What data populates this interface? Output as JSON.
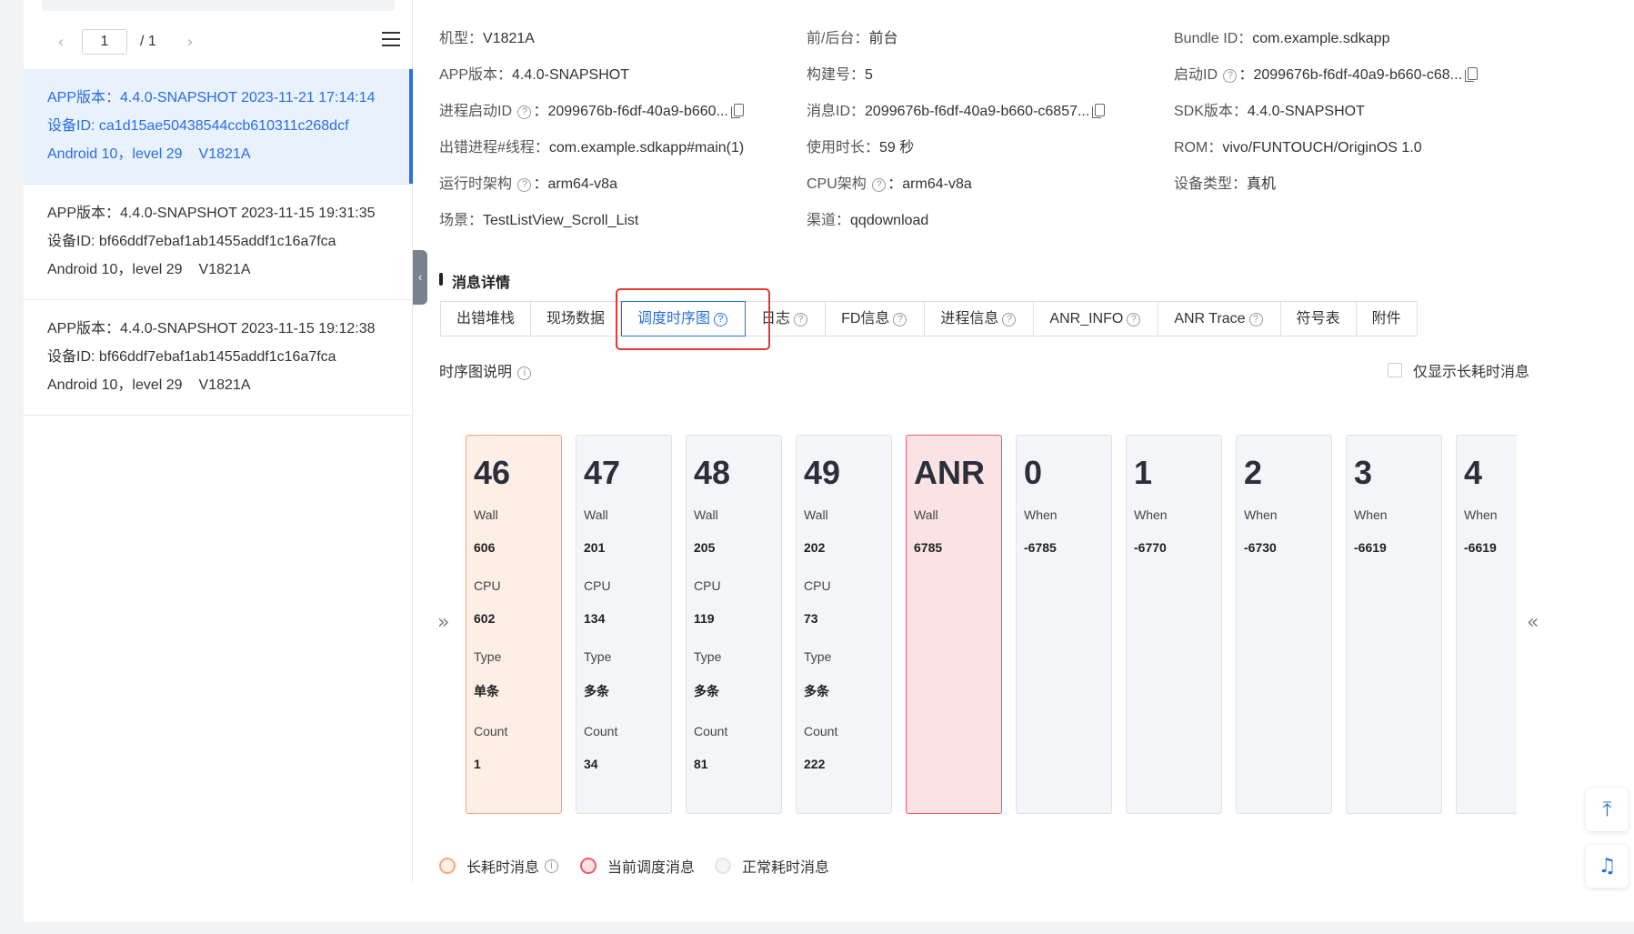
{
  "pager": {
    "current": "1",
    "total": "/ 1",
    "prev": "‹",
    "next": "›"
  },
  "records": [
    {
      "app": "APP版本：4.4.0-SNAPSHOT 2023-11-21 17:14:14",
      "device": "设备ID:   ca1d15ae50438544ccb610311c268dcf",
      "os": "Android 10，level 29",
      "model": "V1821A",
      "selected": true
    },
    {
      "app": "APP版本：4.4.0-SNAPSHOT 2023-11-15 19:31:35",
      "device": "设备ID:   bf66ddf7ebaf1ab1455addf1c16a7fca",
      "os": "Android 10，level 29",
      "model": "V1821A",
      "selected": false
    },
    {
      "app": "APP版本：4.4.0-SNAPSHOT 2023-11-15 19:12:38",
      "device": "设备ID:   bf66ddf7ebaf1ab1455addf1c16a7fca",
      "os": "Android 10，level 29",
      "model": "V1821A",
      "selected": false
    }
  ],
  "info": {
    "model": {
      "k": "机型：",
      "v": "V1821A"
    },
    "fgbg": {
      "k": "前/后台：",
      "v": "前台"
    },
    "bundle": {
      "k": "Bundle ID：",
      "v": "com.example.sdkapp"
    },
    "appver": {
      "k": "APP版本：",
      "v": "4.4.0-SNAPSHOT"
    },
    "build": {
      "k": "构建号：",
      "v": "5"
    },
    "launch_id": {
      "k": "启动ID",
      "v": "2099676b-f6df-40a9-b660-c68..."
    },
    "proc_launch_id": {
      "k": "进程启动ID",
      "v": "2099676b-f6df-40a9-b660..."
    },
    "msg_id": {
      "k": "消息ID：",
      "v": "2099676b-f6df-40a9-b660-c6857..."
    },
    "sdkver": {
      "k": "SDK版本：",
      "v": "4.4.0-SNAPSHOT"
    },
    "thread": {
      "k": "出错进程#线程：",
      "v": "com.example.sdkapp#main(1)"
    },
    "duration": {
      "k": "使用时长：",
      "v": "59 秒"
    },
    "rom": {
      "k": "ROM：",
      "v": "vivo/FUNTOUCH/OriginOS 1.0"
    },
    "run_arch": {
      "k": "运行时架构",
      "v": "arm64-v8a"
    },
    "cpu_arch": {
      "k": "CPU架构",
      "v": "arm64-v8a"
    },
    "dev_type": {
      "k": "设备类型：",
      "v": "真机"
    },
    "scene": {
      "k": "场景：",
      "v": "TestListView_Scroll_List"
    },
    "channel": {
      "k": "渠道：",
      "v": "qqdownload"
    }
  },
  "section_title": "消息详情",
  "tabs": [
    "出错堆栈",
    "现场数据",
    "调度时序图",
    "日志",
    "FD信息",
    "进程信息",
    "ANR_INFO",
    "ANR Trace",
    "符号表",
    "附件"
  ],
  "desc_label": "时序图说明",
  "only_long_label": "仅显示长耗时消息",
  "cards": [
    {
      "id": "46",
      "style": "orange",
      "fields": [
        [
          "Wall",
          "606"
        ],
        [
          "CPU",
          "602"
        ],
        [
          "Type",
          "单条"
        ],
        [
          "Count",
          "1"
        ]
      ]
    },
    {
      "id": "47",
      "style": "normal",
      "fields": [
        [
          "Wall",
          "201"
        ],
        [
          "CPU",
          "134"
        ],
        [
          "Type",
          "多条"
        ],
        [
          "Count",
          "34"
        ]
      ]
    },
    {
      "id": "48",
      "style": "normal",
      "fields": [
        [
          "Wall",
          "205"
        ],
        [
          "CPU",
          "119"
        ],
        [
          "Type",
          "多条"
        ],
        [
          "Count",
          "81"
        ]
      ]
    },
    {
      "id": "49",
      "style": "normal",
      "fields": [
        [
          "Wall",
          "202"
        ],
        [
          "CPU",
          "73"
        ],
        [
          "Type",
          "多条"
        ],
        [
          "Count",
          "222"
        ]
      ]
    },
    {
      "id": "ANR",
      "style": "red",
      "fields": [
        [
          "Wall",
          "6785"
        ]
      ]
    },
    {
      "id": "0",
      "style": "normal",
      "fields": [
        [
          "When",
          "-6785"
        ]
      ]
    },
    {
      "id": "1",
      "style": "normal",
      "fields": [
        [
          "When",
          "-6770"
        ]
      ]
    },
    {
      "id": "2",
      "style": "normal",
      "fields": [
        [
          "When",
          "-6730"
        ]
      ]
    },
    {
      "id": "3",
      "style": "normal",
      "fields": [
        [
          "When",
          "-6619"
        ]
      ]
    },
    {
      "id": "4",
      "style": "normal",
      "fields": [
        [
          "When",
          "-6619"
        ]
      ]
    }
  ],
  "legend": [
    {
      "label": "长耗时消息",
      "color": "#f4a77b",
      "fill": "#fdeee6"
    },
    {
      "label": "当前调度消息",
      "color": "#ee5a66",
      "fill": "#fbe3e5"
    },
    {
      "label": "正常耗时消息",
      "color": "#e3e6ee",
      "fill": "#f4f5f8"
    }
  ],
  "accent": "#2b6ee0"
}
